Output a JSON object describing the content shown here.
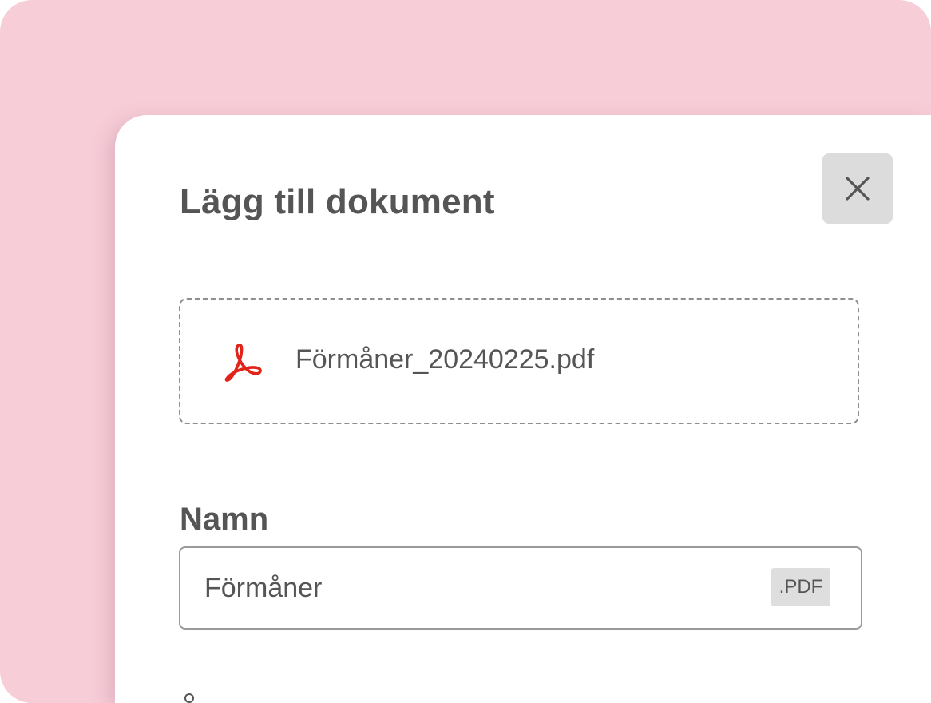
{
  "dialog": {
    "title": "Lägg till dokument",
    "close_icon": "close-icon"
  },
  "dropzone": {
    "file_icon": "pdf-icon",
    "file_name": "Förmåner_20240225.pdf"
  },
  "name_field": {
    "label": "Namn",
    "value": "Förmåner",
    "extension": ".PDF"
  },
  "colors": {
    "backdrop": "#f7cdd8",
    "text": "#555555",
    "pdf_red": "#e2231a",
    "button_bg": "#dcdcdc"
  }
}
